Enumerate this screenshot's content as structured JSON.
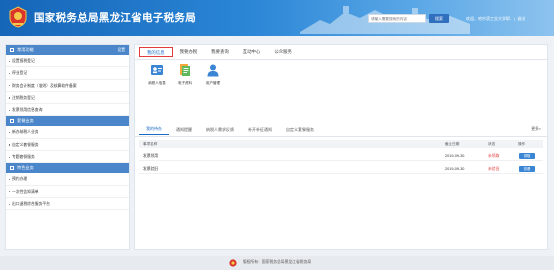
{
  "header": {
    "title": "国家税务总局黑龙江省电子税务局",
    "search_placeholder": "请输入需要搜索的内容",
    "search_button": "搜索",
    "welcome": "欢迎，哈尔滨工业大学职..",
    "logout": "退出"
  },
  "sidebar": {
    "sections": [
      {
        "title": "常用功能",
        "settings": "设置",
        "items": [
          "设置报税登记",
          "停业登记",
          "财务会计制度（准则）及核算软件备案",
          "注销税务登记",
          "发票领用信息查询"
        ]
      },
      {
        "title": "套餐业务",
        "items": [
          "新办纳税人业务",
          "自定义套餐服务",
          "专题套餐服务"
        ]
      },
      {
        "title": "特色业务",
        "items": [
          "预约办理",
          "一次性告知清单",
          "出口退税综合服务平台"
        ]
      }
    ]
  },
  "main": {
    "tabs": [
      "我的信息",
      "我要办税",
      "我要查询",
      "互动中心",
      "公众服务"
    ],
    "active_tab": "我的信息",
    "tiles": [
      {
        "label": "纳税人信息",
        "icon": "taxpayer-info-icon"
      },
      {
        "label": "电子资料",
        "icon": "electronic-docs-icon"
      },
      {
        "label": "用户管理",
        "icon": "user-management-icon"
      }
    ],
    "sub_tabs": [
      "我的待办",
      "通知提醒",
      "纳税人需求反馈",
      "补开补征通知",
      "自定义套餐服务"
    ],
    "more": "更多>",
    "table": {
      "headers": [
        "事项名称",
        "截止日期",
        "状态",
        "操作"
      ],
      "rows": [
        {
          "name": "发票领用",
          "date": "2019-09-30",
          "status": "未领取",
          "action": "领取"
        },
        {
          "name": "发票验旧",
          "date": "2019-09-30",
          "status": "未验旧",
          "action": "查看"
        }
      ]
    }
  },
  "footer": {
    "text": "版权所有：国家税务总局黑龙江省税务局"
  },
  "colors": {
    "header_gradient_start": "#1565b8",
    "sidebar_header": "#4a86c9",
    "accent_blue": "#1c6cc7",
    "status_red": "#e33c3c"
  }
}
